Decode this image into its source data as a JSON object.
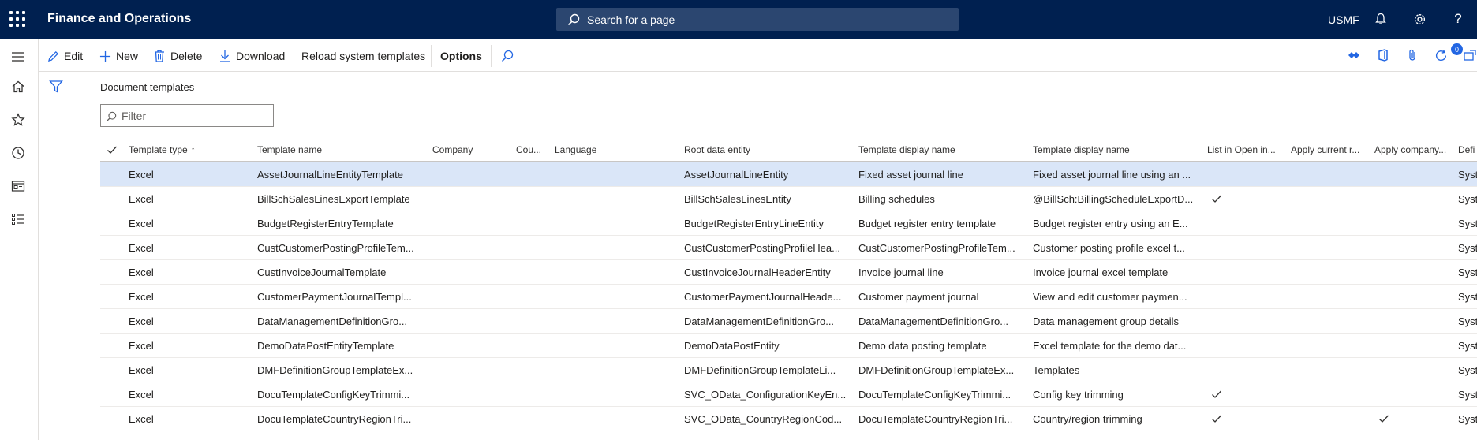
{
  "topbar": {
    "app_title": "Finance and Operations",
    "search_placeholder": "Search for a page",
    "company": "USMF",
    "help_label": "?"
  },
  "actions": {
    "edit": "Edit",
    "new": "New",
    "delete": "Delete",
    "download": "Download",
    "reload": "Reload system templates",
    "options": "Options"
  },
  "notification_badge": "0",
  "page": {
    "caption": "Document templates",
    "filter_placeholder": "Filter"
  },
  "grid": {
    "columns": [
      "Template type",
      "Template name",
      "Company",
      "Cou...",
      "Language",
      "Root data entity",
      "Template display name",
      "Template display name",
      "List in Open in...",
      "Apply current r...",
      "Apply company...",
      "Defi"
    ],
    "rows": [
      {
        "type": "Excel",
        "name": "AssetJournalLineEntityTemplate",
        "company": "",
        "country": "",
        "language": "",
        "root": "AssetJournalLineEntity",
        "display": "Fixed asset journal line",
        "display2": "Fixed asset journal line using an ...",
        "list": false,
        "apply_current": false,
        "apply_company": false,
        "defi": "Syst"
      },
      {
        "type": "Excel",
        "name": "BillSchSalesLinesExportTemplate",
        "company": "",
        "country": "",
        "language": "",
        "root": "BillSchSalesLinesEntity",
        "display": "Billing schedules",
        "display2": "@BillSch:BillingScheduleExportD...",
        "list": true,
        "apply_current": false,
        "apply_company": false,
        "defi": "Syst"
      },
      {
        "type": "Excel",
        "name": "BudgetRegisterEntryTemplate",
        "company": "",
        "country": "",
        "language": "",
        "root": "BudgetRegisterEntryLineEntity",
        "display": "Budget register entry template",
        "display2": "Budget register entry using an E...",
        "list": false,
        "apply_current": false,
        "apply_company": false,
        "defi": "Syst"
      },
      {
        "type": "Excel",
        "name": "CustCustomerPostingProfileTem...",
        "company": "",
        "country": "",
        "language": "",
        "root": "CustCustomerPostingProfileHea...",
        "display": "CustCustomerPostingProfileTem...",
        "display2": "Customer posting profile excel t...",
        "list": false,
        "apply_current": false,
        "apply_company": false,
        "defi": "Syst"
      },
      {
        "type": "Excel",
        "name": "CustInvoiceJournalTemplate",
        "company": "",
        "country": "",
        "language": "",
        "root": "CustInvoiceJournalHeaderEntity",
        "display": "Invoice journal line",
        "display2": "Invoice journal excel template",
        "list": false,
        "apply_current": false,
        "apply_company": false,
        "defi": "Syst"
      },
      {
        "type": "Excel",
        "name": "CustomerPaymentJournalTempl...",
        "company": "",
        "country": "",
        "language": "",
        "root": "CustomerPaymentJournalHeade...",
        "display": "Customer payment journal",
        "display2": "View and edit customer paymen...",
        "list": false,
        "apply_current": false,
        "apply_company": false,
        "defi": "Syst"
      },
      {
        "type": "Excel",
        "name": "DataManagementDefinitionGro...",
        "company": "",
        "country": "",
        "language": "",
        "root": "DataManagementDefinitionGro...",
        "display": "DataManagementDefinitionGro...",
        "display2": "Data management group details",
        "list": false,
        "apply_current": false,
        "apply_company": false,
        "defi": "Syst"
      },
      {
        "type": "Excel",
        "name": "DemoDataPostEntityTemplate",
        "company": "",
        "country": "",
        "language": "",
        "root": "DemoDataPostEntity",
        "display": "Demo data posting template",
        "display2": "Excel template for the demo dat...",
        "list": false,
        "apply_current": false,
        "apply_company": false,
        "defi": "Syst"
      },
      {
        "type": "Excel",
        "name": "DMFDefinitionGroupTemplateEx...",
        "company": "",
        "country": "",
        "language": "",
        "root": "DMFDefinitionGroupTemplateLi...",
        "display": "DMFDefinitionGroupTemplateEx...",
        "display2": "Templates",
        "list": false,
        "apply_current": false,
        "apply_company": false,
        "defi": "Syst"
      },
      {
        "type": "Excel",
        "name": "DocuTemplateConfigKeyTrimmi...",
        "company": "",
        "country": "",
        "language": "",
        "root": "SVC_OData_ConfigurationKeyEn...",
        "display": "DocuTemplateConfigKeyTrimmi...",
        "display2": "Config key trimming",
        "list": true,
        "apply_current": false,
        "apply_company": false,
        "defi": "Syst"
      },
      {
        "type": "Excel",
        "name": "DocuTemplateCountryRegionTri...",
        "company": "",
        "country": "",
        "language": "",
        "root": "SVC_OData_CountryRegionCod...",
        "display": "DocuTemplateCountryRegionTri...",
        "display2": "Country/region trimming",
        "list": true,
        "apply_current": false,
        "apply_company": true,
        "defi": "Syst"
      }
    ]
  }
}
